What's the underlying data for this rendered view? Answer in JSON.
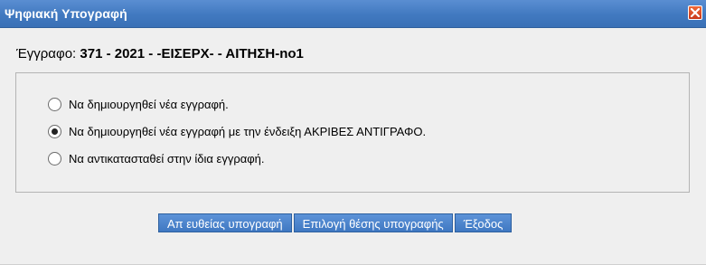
{
  "dialog": {
    "title": "Ψηφιακή Υπογραφή",
    "close_icon": "close-icon"
  },
  "document": {
    "label": "Έγγραφο:",
    "value": "371 - 2021 - -ΕΙΣΕΡΧ- - ΑΙΤΗΣΗ-no1"
  },
  "options": [
    {
      "label": "Να δημιουργηθεί νέα εγγραφή.",
      "selected": false
    },
    {
      "label": "Να δημιουργηθεί νέα εγγραφή με την ένδειξη ΑΚΡΙΒΕΣ ΑΝΤΙΓΡΑΦΟ.",
      "selected": true
    },
    {
      "label": "Να αντικατασταθεί στην ίδια εγγραφή.",
      "selected": false
    }
  ],
  "buttons": {
    "direct_sign": "Απ ευθείας υπογραφή",
    "choose_position": "Επιλογή θέσης υπογραφής",
    "exit": "Έξοδος"
  },
  "colors": {
    "titlebar": "#4179c0",
    "button": "#4a82cb",
    "close": "#d9472a"
  }
}
